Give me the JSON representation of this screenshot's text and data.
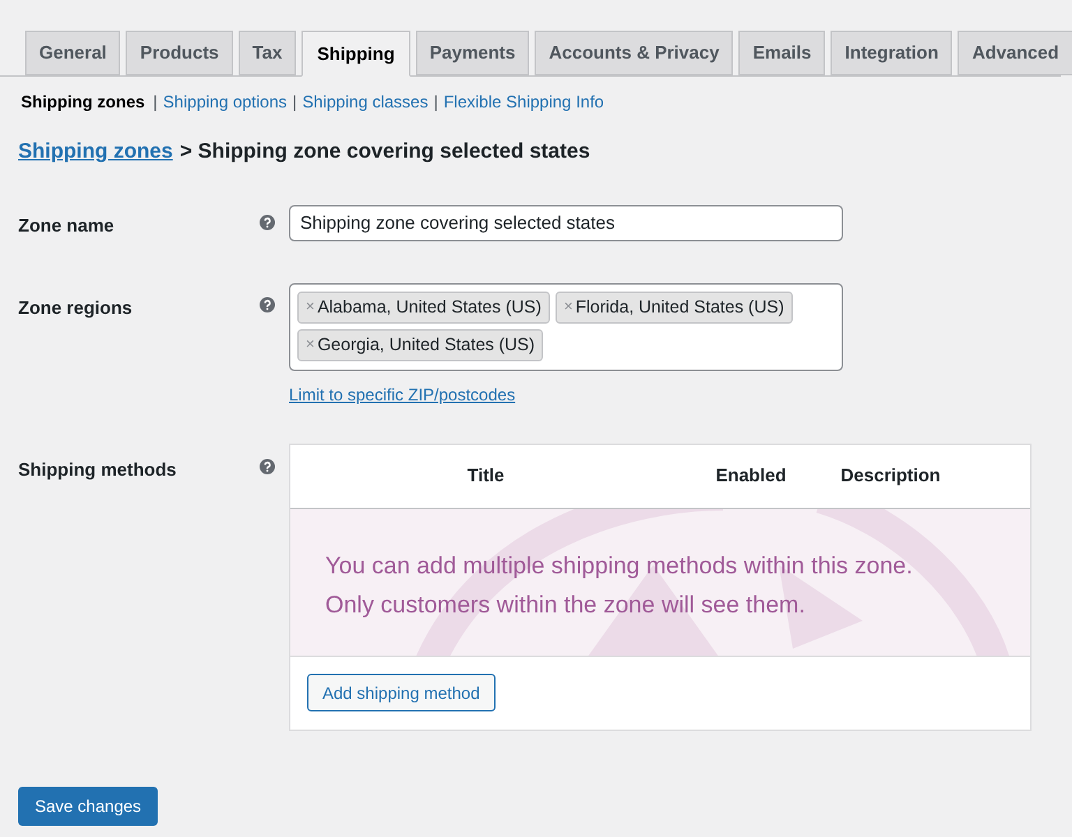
{
  "tabs": [
    {
      "label": "General",
      "selected": false
    },
    {
      "label": "Products",
      "selected": false
    },
    {
      "label": "Tax",
      "selected": false
    },
    {
      "label": "Shipping",
      "selected": true
    },
    {
      "label": "Payments",
      "selected": false
    },
    {
      "label": "Accounts & Privacy",
      "selected": false
    },
    {
      "label": "Emails",
      "selected": false
    },
    {
      "label": "Integration",
      "selected": false
    },
    {
      "label": "Advanced",
      "selected": false
    }
  ],
  "subnav": [
    {
      "label": "Shipping zones",
      "selected": true
    },
    {
      "separator": "|",
      "label": "Shipping options",
      "selected": false
    },
    {
      "separator": "|",
      "label": "Shipping classes",
      "selected": false
    },
    {
      "separator": "|",
      "label": "Flexible Shipping Info",
      "selected": false
    }
  ],
  "breadcrumb": {
    "link": "Shipping zones",
    "rest": "> Shipping zone covering selected states"
  },
  "zone_name": {
    "label": "Zone name",
    "value": "Shipping zone covering selected states"
  },
  "zone_regions": {
    "label": "Zone regions",
    "tags": [
      {
        "remove": "×",
        "label": "Alabama, United States (US)"
      },
      {
        "remove": "×",
        "label": "Florida, United States (US)"
      },
      {
        "remove": "×",
        "label": "Georgia, United States (US)"
      }
    ],
    "link": "Limit to specific ZIP/postcodes"
  },
  "shipping_methods": {
    "label": "Shipping methods",
    "columns": [
      "Title",
      "Enabled",
      "Description"
    ],
    "empty_message": [
      "You can add multiple shipping methods within this zone.",
      "Only customers within the zone will see them."
    ],
    "add_button": "Add shipping method"
  },
  "save_button": "Save changes"
}
